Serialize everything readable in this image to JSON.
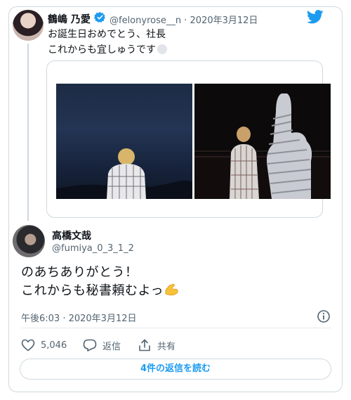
{
  "tweet1": {
    "name": "鶴嶋 乃愛",
    "handle": "@felonyrose__n",
    "date": "2020年3月12日",
    "separator": "·",
    "text": "お誕生日おめでとう、社長\nこれからも宜しゅうです",
    "verified_icon": "verified-badge-icon"
  },
  "tweet2": {
    "name": "高橋文哉",
    "handle": "@fumiya_0_3_1_2",
    "text": "のあちありがとう！\nこれからも秘書頼むよっ",
    "emoji": "flexed-biceps-icon",
    "timestamp": "午後6:03 · 2020年3月12日"
  },
  "actions": {
    "like_count": "5,046",
    "reply_label": "返信",
    "share_label": "共有"
  },
  "replies_button": "4件の返信を読む",
  "colors": {
    "accent": "#1d9bf0",
    "secondary_text": "#536471",
    "border": "#cfd9de"
  }
}
